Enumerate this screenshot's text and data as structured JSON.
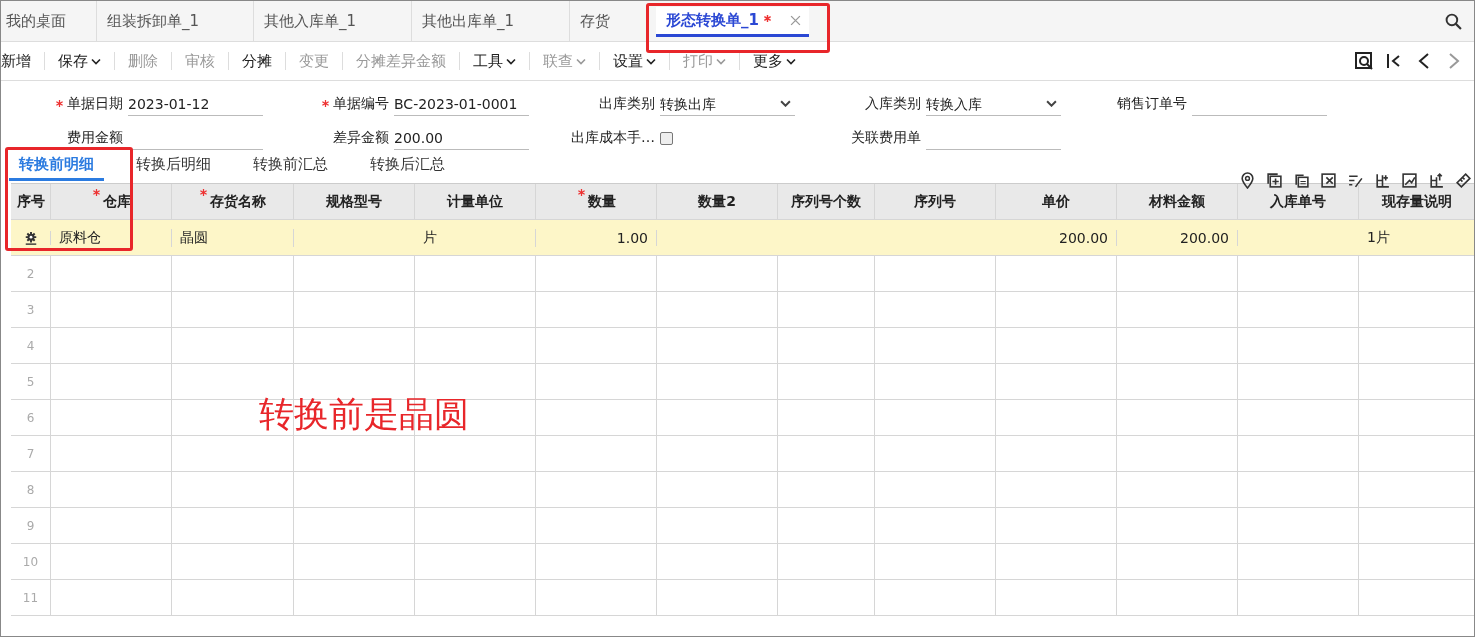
{
  "tabs": [
    {
      "label": "我的桌面",
      "selected": false,
      "modified": false
    },
    {
      "label": "组装拆卸单_1",
      "selected": false,
      "modified": false
    },
    {
      "label": "其他入库单_1",
      "selected": false,
      "modified": false
    },
    {
      "label": "其他出库单_1",
      "selected": false,
      "modified": false
    },
    {
      "label": "存货",
      "selected": false,
      "modified": false
    },
    {
      "label": "形态转换单_1",
      "selected": true,
      "modified": true
    }
  ],
  "toolbar": [
    {
      "label": "新增",
      "disabled": false,
      "dropdown": false
    },
    {
      "label": "保存",
      "disabled": false,
      "dropdown": true
    },
    {
      "label": "删除",
      "disabled": true,
      "dropdown": false
    },
    {
      "label": "审核",
      "disabled": true,
      "dropdown": false
    },
    {
      "label": "分摊",
      "disabled": false,
      "dropdown": false
    },
    {
      "label": "变更",
      "disabled": true,
      "dropdown": false
    },
    {
      "label": "分摊差异金额",
      "disabled": true,
      "dropdown": false
    },
    {
      "label": "工具",
      "disabled": false,
      "dropdown": true
    },
    {
      "label": "联查",
      "disabled": true,
      "dropdown": true
    },
    {
      "label": "设置",
      "disabled": false,
      "dropdown": true
    },
    {
      "label": "打印",
      "disabled": true,
      "dropdown": true
    },
    {
      "label": "更多",
      "disabled": false,
      "dropdown": true
    }
  ],
  "form_rows": [
    [
      {
        "label": "单据日期",
        "required": true,
        "kind": "text",
        "value": "2023-01-12"
      },
      {
        "label": "单据编号",
        "required": true,
        "kind": "text",
        "value": "BC-2023-01-0001"
      },
      {
        "label": "出库类别",
        "required": false,
        "kind": "select",
        "value": "转换出库"
      },
      {
        "label": "入库类别",
        "required": false,
        "kind": "select",
        "value": "转换入库"
      },
      {
        "label": "销售订单号",
        "required": false,
        "kind": "text"
      }
    ],
    [
      {
        "label": "费用金额",
        "required": false,
        "kind": "text"
      },
      {
        "label": "差异金额",
        "required": false,
        "kind": "text",
        "value": "200.00"
      },
      {
        "label": "出库成本手…",
        "required": false,
        "kind": "checkbox",
        "checked": false
      },
      {
        "label": "关联费用单",
        "required": false,
        "kind": "text"
      }
    ]
  ],
  "sub_tabs": [
    {
      "label": "转换前明细",
      "selected": true
    },
    {
      "label": "转换后明细",
      "selected": false
    },
    {
      "label": "转换前汇总",
      "selected": false
    },
    {
      "label": "转换后汇总",
      "selected": false
    }
  ],
  "table": {
    "columns": [
      {
        "label": "序号",
        "required": false
      },
      {
        "label": "仓库",
        "required": true
      },
      {
        "label": "存货名称",
        "required": true
      },
      {
        "label": "规格型号",
        "required": false
      },
      {
        "label": "计量单位",
        "required": false
      },
      {
        "label": "数量",
        "required": true
      },
      {
        "label": "数量2",
        "required": false
      },
      {
        "label": "序列号个数",
        "required": false
      },
      {
        "label": "序列号",
        "required": false
      },
      {
        "label": "单价",
        "required": false
      },
      {
        "label": "材料金额",
        "required": false
      },
      {
        "label": "入库单号",
        "required": false
      },
      {
        "label": "现存量说明",
        "required": false
      }
    ],
    "rows": [
      {
        "selected": true,
        "cells": [
          "",
          "原料仓",
          "晶圆",
          "",
          "片",
          "1.00",
          "",
          "",
          "",
          "200.00",
          "200.00",
          "",
          "1片"
        ]
      },
      {
        "selected": false,
        "cells": [
          "2"
        ]
      },
      {
        "selected": false,
        "cells": [
          "3"
        ]
      },
      {
        "selected": false,
        "cells": [
          "4"
        ]
      },
      {
        "selected": false,
        "cells": [
          "5"
        ]
      },
      {
        "selected": false,
        "cells": [
          "6"
        ]
      },
      {
        "selected": false,
        "cells": [
          "7"
        ]
      },
      {
        "selected": false,
        "cells": [
          "8"
        ]
      },
      {
        "selected": false,
        "cells": [
          "9"
        ]
      },
      {
        "selected": false,
        "cells": [
          "10"
        ]
      },
      {
        "selected": false,
        "cells": [
          "11"
        ]
      }
    ]
  },
  "annotation": "转换前是晶圆"
}
